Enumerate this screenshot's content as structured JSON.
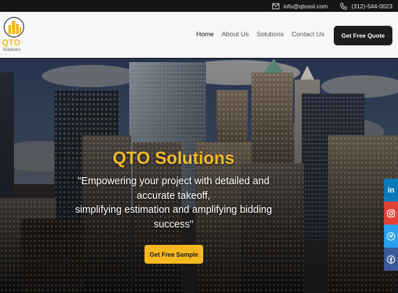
{
  "topbar": {
    "email": "info@qtosol.com",
    "phone": "(312)-544-0023"
  },
  "logo": {
    "brand": "QTO",
    "sub": "Solutions"
  },
  "nav": {
    "items": [
      "Home",
      "About Us",
      "Solutions",
      "Contact Us"
    ],
    "cta": "Get Free Quote"
  },
  "hero": {
    "title": "QTO Solutions",
    "tagline_lines": [
      "\"Empowering your project with detailed and",
      "accurate takeoff,",
      "simplifying estimation and amplifying bidding",
      "success\""
    ],
    "button": "Get Free Sample"
  },
  "social": [
    "linkedin-icon",
    "instagram-icon",
    "twitter-icon",
    "facebook-icon"
  ],
  "colors": {
    "accent": "#f0b92b",
    "dark": "#1d1d1d",
    "linkedin": "#0b79b8",
    "instagram": "#e24339",
    "twitter": "#2ba1ee",
    "facebook": "#3b5a9a"
  }
}
